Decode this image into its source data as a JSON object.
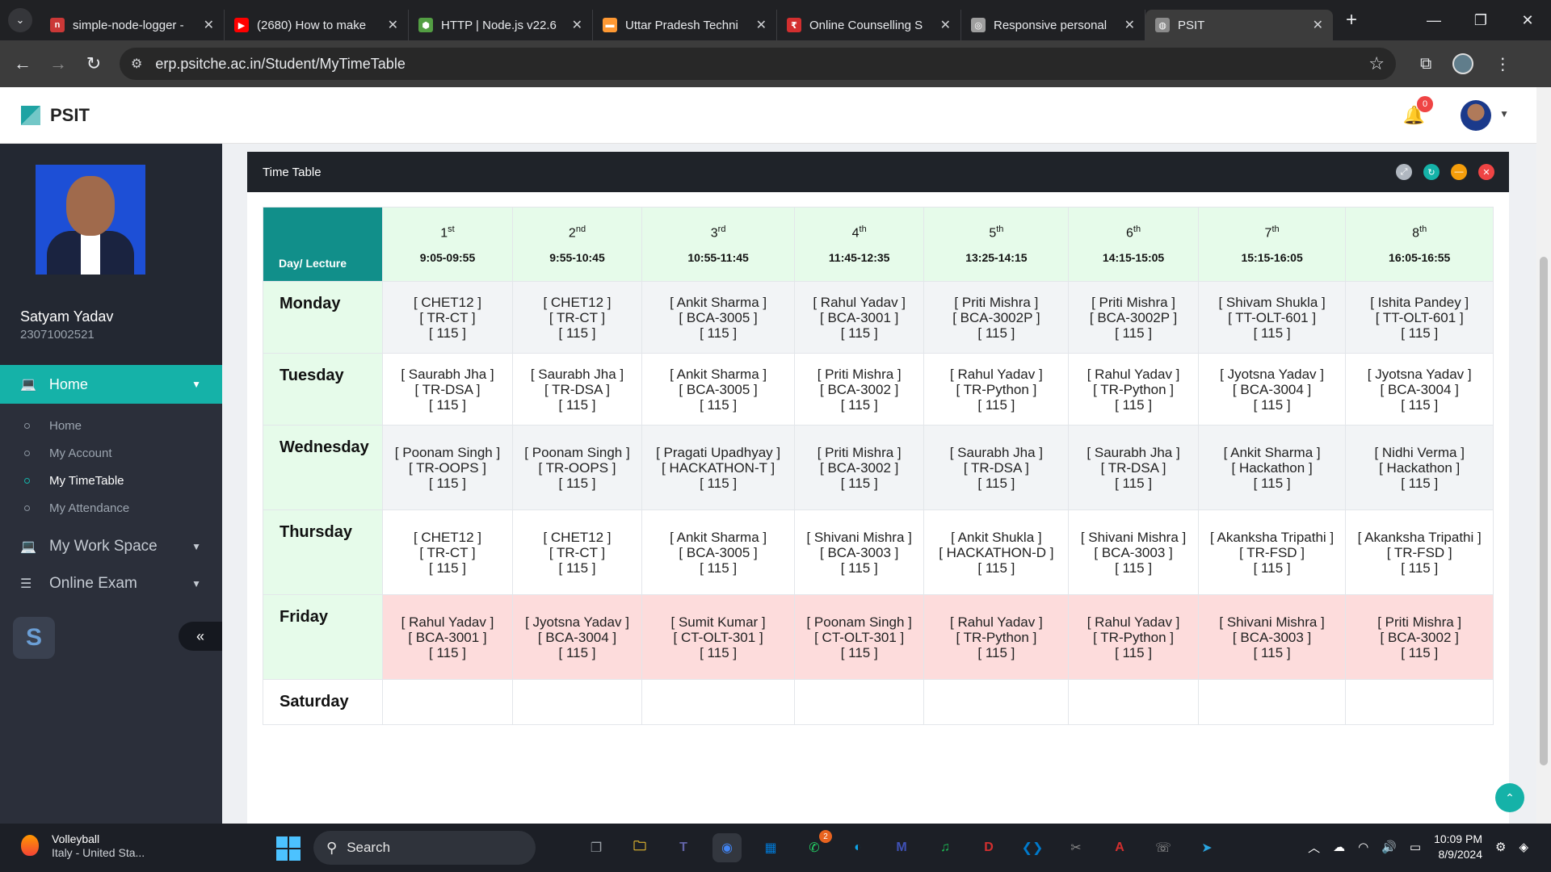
{
  "browser": {
    "tabs": [
      {
        "title": "simple-node-logger -",
        "favicon_color": "#cb3837",
        "favicon_glyph": "n"
      },
      {
        "title": "(2680) How to make",
        "favicon_color": "#ff0000",
        "favicon_glyph": "▶"
      },
      {
        "title": "HTTP | Node.js v22.6",
        "favicon_color": "#539e43",
        "favicon_glyph": "⬢"
      },
      {
        "title": "Uttar Pradesh Techni",
        "favicon_color": "#ff9933",
        "favicon_glyph": "▬"
      },
      {
        "title": "Online Counselling S",
        "favicon_color": "#d32f2f",
        "favicon_glyph": "₹"
      },
      {
        "title": "Responsive personal",
        "favicon_color": "#9e9e9e",
        "favicon_glyph": "◎"
      },
      {
        "title": "PSIT",
        "favicon_color": "#8a8a8a",
        "favicon_glyph": "◍",
        "active": true
      }
    ],
    "url": "erp.psitche.ac.in/Student/MyTimeTable"
  },
  "header": {
    "brand": "PSIT",
    "notification_count": "0"
  },
  "sidebar": {
    "student_name": "Satyam Yadav",
    "student_id": "23071002521",
    "home_label": "Home",
    "sub_items": [
      {
        "label": "Home"
      },
      {
        "label": "My Account"
      },
      {
        "label": "My TimeTable",
        "active": true
      },
      {
        "label": "My Attendance"
      }
    ],
    "workspace_label": "My Work Space",
    "exam_label": "Online Exam"
  },
  "panel": {
    "title": "Time Table"
  },
  "timetable": {
    "corner_label": "Day/ Lecture",
    "lectures": [
      {
        "n": "1",
        "suffix": "st",
        "time": "9:05-09:55"
      },
      {
        "n": "2",
        "suffix": "nd",
        "time": "9:55-10:45"
      },
      {
        "n": "3",
        "suffix": "rd",
        "time": "10:55-11:45"
      },
      {
        "n": "4",
        "suffix": "th",
        "time": "11:45-12:35"
      },
      {
        "n": "5",
        "suffix": "th",
        "time": "13:25-14:15"
      },
      {
        "n": "6",
        "suffix": "th",
        "time": "14:15-15:05"
      },
      {
        "n": "7",
        "suffix": "th",
        "time": "15:15-16:05"
      },
      {
        "n": "8",
        "suffix": "th",
        "time": "16:05-16:55"
      }
    ],
    "days": [
      {
        "day": "Monday",
        "cells": [
          {
            "teacher": "[ CHET12 ]",
            "subject": "[ TR-CT ]",
            "room": "[ 115 ]"
          },
          {
            "teacher": "[ CHET12 ]",
            "subject": "[ TR-CT ]",
            "room": "[ 115 ]"
          },
          {
            "teacher": "[ Ankit Sharma ]",
            "subject": "[ BCA-3005 ]",
            "room": "[ 115 ]"
          },
          {
            "teacher": "[ Rahul Yadav ]",
            "subject": "[ BCA-3001 ]",
            "room": "[ 115 ]"
          },
          {
            "teacher": "[ Priti Mishra ]",
            "subject": "[ BCA-3002P ]",
            "room": "[ 115 ]"
          },
          {
            "teacher": "[ Priti Mishra ]",
            "subject": "[ BCA-3002P ]",
            "room": "[ 115 ]"
          },
          {
            "teacher": "[ Shivam Shukla ]",
            "subject": "[ TT-OLT-601 ]",
            "room": "[ 115 ]"
          },
          {
            "teacher": "[ Ishita Pandey ]",
            "subject": "[ TT-OLT-601 ]",
            "room": "[ 115 ]"
          }
        ]
      },
      {
        "day": "Tuesday",
        "cells": [
          {
            "teacher": "[ Saurabh Jha ]",
            "subject": "[ TR-DSA ]",
            "room": "[ 115 ]"
          },
          {
            "teacher": "[ Saurabh Jha ]",
            "subject": "[ TR-DSA ]",
            "room": "[ 115 ]"
          },
          {
            "teacher": "[ Ankit Sharma ]",
            "subject": "[ BCA-3005 ]",
            "room": "[ 115 ]"
          },
          {
            "teacher": "[ Priti Mishra ]",
            "subject": "[ BCA-3002 ]",
            "room": "[ 115 ]"
          },
          {
            "teacher": "[ Rahul Yadav ]",
            "subject": "[ TR-Python ]",
            "room": "[ 115 ]"
          },
          {
            "teacher": "[ Rahul Yadav ]",
            "subject": "[ TR-Python ]",
            "room": "[ 115 ]"
          },
          {
            "teacher": "[ Jyotsna Yadav ]",
            "subject": "[ BCA-3004 ]",
            "room": "[ 115 ]"
          },
          {
            "teacher": "[ Jyotsna Yadav ]",
            "subject": "[ BCA-3004 ]",
            "room": "[ 115 ]"
          }
        ]
      },
      {
        "day": "Wednesday",
        "cells": [
          {
            "teacher": "[ Poonam Singh ]",
            "subject": "[ TR-OOPS ]",
            "room": "[ 115 ]"
          },
          {
            "teacher": "[ Poonam Singh ]",
            "subject": "[ TR-OOPS ]",
            "room": "[ 115 ]"
          },
          {
            "teacher": "[ Pragati Upadhyay ]",
            "subject": "[ HACKATHON-T ]",
            "room": "[ 115 ]"
          },
          {
            "teacher": "[ Priti Mishra ]",
            "subject": "[ BCA-3002 ]",
            "room": "[ 115 ]"
          },
          {
            "teacher": "[ Saurabh Jha ]",
            "subject": "[ TR-DSA ]",
            "room": "[ 115 ]"
          },
          {
            "teacher": "[ Saurabh Jha ]",
            "subject": "[ TR-DSA ]",
            "room": "[ 115 ]"
          },
          {
            "teacher": "[ Ankit Sharma ]",
            "subject": "[ Hackathon ]",
            "room": "[ 115 ]"
          },
          {
            "teacher": "[ Nidhi Verma ]",
            "subject": "[ Hackathon ]",
            "room": "[ 115 ]"
          }
        ]
      },
      {
        "day": "Thursday",
        "cells": [
          {
            "teacher": "[ CHET12 ]",
            "subject": "[ TR-CT ]",
            "room": "[ 115 ]"
          },
          {
            "teacher": "[ CHET12 ]",
            "subject": "[ TR-CT ]",
            "room": "[ 115 ]"
          },
          {
            "teacher": "[ Ankit Sharma ]",
            "subject": "[ BCA-3005 ]",
            "room": "[ 115 ]"
          },
          {
            "teacher": "[ Shivani Mishra ]",
            "subject": "[ BCA-3003 ]",
            "room": "[ 115 ]"
          },
          {
            "teacher": "[ Ankit Shukla ]",
            "subject": "[ HACKATHON-D ]",
            "room": "[ 115 ]"
          },
          {
            "teacher": "[ Shivani Mishra ]",
            "subject": "[ BCA-3003 ]",
            "room": "[ 115 ]"
          },
          {
            "teacher": "[ Akanksha Tripathi ]",
            "subject": "[ TR-FSD ]",
            "room": "[ 115 ]"
          },
          {
            "teacher": "[ Akanksha Tripathi ]",
            "subject": "[ TR-FSD ]",
            "room": "[ 115 ]"
          }
        ]
      },
      {
        "day": "Friday",
        "cells": [
          {
            "teacher": "[ Rahul Yadav ]",
            "subject": "[ BCA-3001 ]",
            "room": "[ 115 ]"
          },
          {
            "teacher": "[ Jyotsna Yadav ]",
            "subject": "[ BCA-3004 ]",
            "room": "[ 115 ]"
          },
          {
            "teacher": "[ Sumit Kumar ]",
            "subject": "[ CT-OLT-301 ]",
            "room": "[ 115 ]"
          },
          {
            "teacher": "[ Poonam Singh ]",
            "subject": "[ CT-OLT-301 ]",
            "room": "[ 115 ]"
          },
          {
            "teacher": "[ Rahul Yadav ]",
            "subject": "[ TR-Python ]",
            "room": "[ 115 ]"
          },
          {
            "teacher": "[ Rahul Yadav ]",
            "subject": "[ TR-Python ]",
            "room": "[ 115 ]"
          },
          {
            "teacher": "[ Shivani Mishra ]",
            "subject": "[ BCA-3003 ]",
            "room": "[ 115 ]"
          },
          {
            "teacher": "[ Priti Mishra ]",
            "subject": "[ BCA-3002 ]",
            "room": "[ 115 ]"
          }
        ]
      },
      {
        "day": "Saturday",
        "cells": [
          {
            "teacher": "",
            "subject": "",
            "room": ""
          },
          {
            "teacher": "",
            "subject": "",
            "room": ""
          },
          {
            "teacher": "",
            "subject": "",
            "room": ""
          },
          {
            "teacher": "",
            "subject": "",
            "room": ""
          },
          {
            "teacher": "",
            "subject": "",
            "room": ""
          },
          {
            "teacher": "",
            "subject": "",
            "room": ""
          },
          {
            "teacher": "",
            "subject": "",
            "room": ""
          },
          {
            "teacher": "",
            "subject": "",
            "room": ""
          }
        ]
      }
    ]
  },
  "taskbar": {
    "weather_title": "Volleyball",
    "weather_sub": "Italy - United Sta...",
    "search_label": "Search",
    "apps": [
      {
        "name": "task-view",
        "glyph": "❐",
        "color": "#9aa0a6"
      },
      {
        "name": "file-explorer",
        "glyph": "🗀",
        "color": "#f4c430"
      },
      {
        "name": "teams",
        "glyph": "T",
        "color": "#6264a7"
      },
      {
        "name": "chrome",
        "glyph": "◉",
        "color": "#4285f4",
        "selected": true
      },
      {
        "name": "microsoft-store",
        "glyph": "▦",
        "color": "#0078d4"
      },
      {
        "name": "whatsapp",
        "glyph": "✆",
        "color": "#25d366",
        "badge": "2"
      },
      {
        "name": "edge",
        "glyph": "◐",
        "color": "#0ea5e9"
      },
      {
        "name": "mongodb-compass",
        "glyph": "M",
        "color": "#3f51b5"
      },
      {
        "name": "spotify",
        "glyph": "♫",
        "color": "#1db954"
      },
      {
        "name": "dev-cpp",
        "glyph": "D",
        "color": "#d32f2f"
      },
      {
        "name": "vs-code",
        "glyph": "❮❯",
        "color": "#007acc"
      },
      {
        "name": "snipping-tool",
        "glyph": "✂",
        "color": "#8a8a8a"
      },
      {
        "name": "acrobat",
        "glyph": "A",
        "color": "#d32f2f"
      },
      {
        "name": "whatsapp-web",
        "glyph": "☏",
        "color": "#a0a0a0"
      },
      {
        "name": "telegram",
        "glyph": "➤",
        "color": "#2aa5e0"
      }
    ],
    "time": "10:09 PM",
    "date": "8/9/2024"
  }
}
